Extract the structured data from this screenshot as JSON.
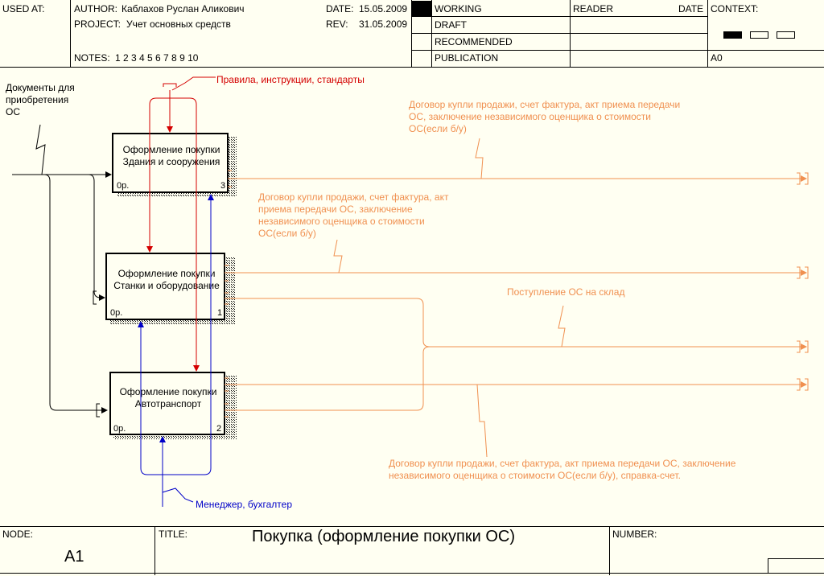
{
  "header": {
    "used_at_label": "USED AT:",
    "author_label": "AUTHOR:",
    "author": "Каблахов Руслан Аликович",
    "project_label": "PROJECT:",
    "project": "Учет основных средств",
    "date_label": "DATE:",
    "date": "15.05.2009",
    "rev_label": "REV:",
    "rev": "31.05.2009",
    "notes_label": "NOTES:",
    "notes": "1 2 3 4 5 6 7 8 9 10",
    "status": [
      "WORKING",
      "DRAFT",
      "RECOMMENDED",
      "PUBLICATION"
    ],
    "reader_label": "READER",
    "reader_date_label": "DATE",
    "context_label": "CONTEXT:",
    "context_node": "A0"
  },
  "diagram": {
    "colors": {
      "control": "#d40000",
      "mechanism": "#0000c8",
      "output": "#f09050",
      "input": "#000000"
    },
    "boxes": [
      {
        "title1": "Оформление покупки",
        "title2": "Здания и сооружения",
        "cost": "0р.",
        "num": "3"
      },
      {
        "title1": "Оформление покупки",
        "title2": "Станки и оборудование",
        "cost": "0р.",
        "num": "1"
      },
      {
        "title1": "Оформление покупки",
        "title2": "Автотранспорт",
        "cost": "0р.",
        "num": "2"
      }
    ],
    "labels": {
      "input_docs": [
        "Документы для",
        "приобретения",
        "ОС"
      ],
      "control": "Правила, инструкции, стандарты",
      "output_top": [
        "Договор купли продажи, счет фактура, акт приема передачи",
        "ОС, заключение независимого оценщика о стоимости",
        "ОС(если б/у)"
      ],
      "output_mid": [
        "Договор купли продажи, счет фактура, акт",
        "приема передачи ОС, заключение",
        "независимого оценщика о стоимости",
        "ОС(если б/у)"
      ],
      "output_warehouse": "Поступление ОС на склад",
      "output_bottom": [
        "Договор купли продажи, счет фактура, акт приема передачи ОС, заключение",
        "независимого оценщика о стоимости ОС(если б/у), справка-счет."
      ],
      "mechanism": "Менеджер, бухгалтер"
    }
  },
  "footer": {
    "node_label": "NODE:",
    "node": "A1",
    "title_label": "TITLE:",
    "title": "Покупка (оформление покупки ОС)",
    "number_label": "NUMBER:"
  }
}
